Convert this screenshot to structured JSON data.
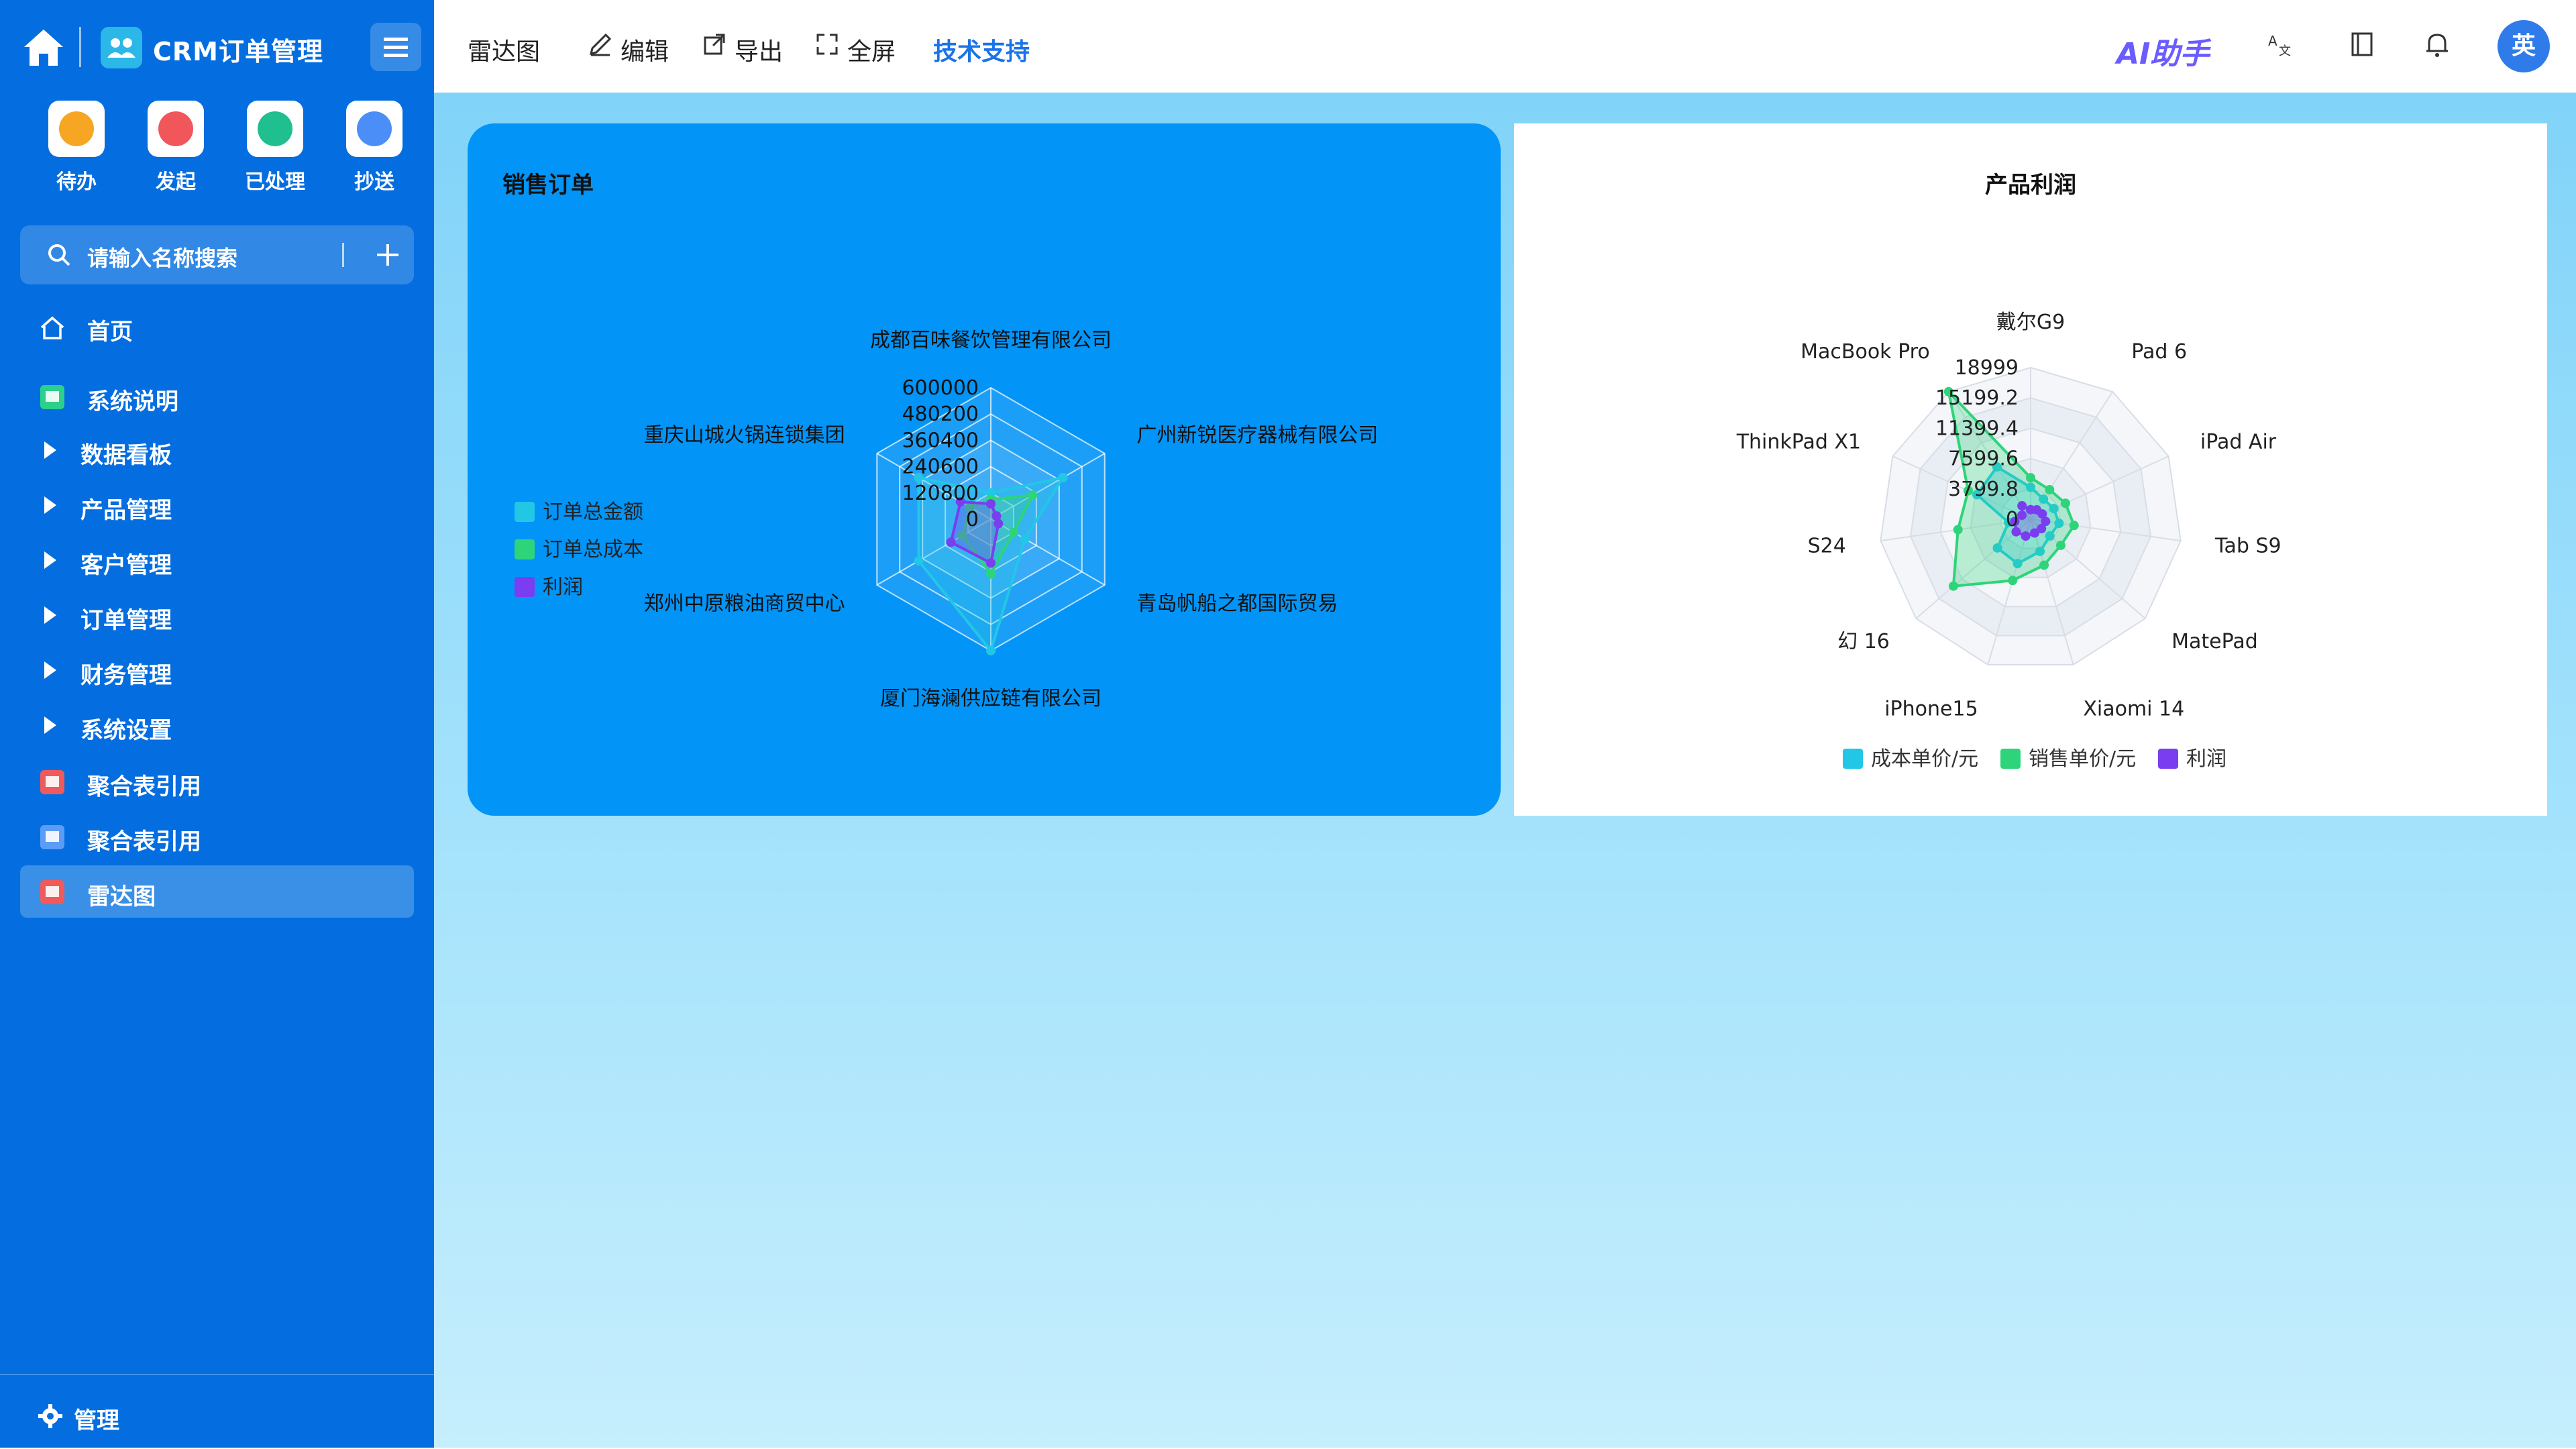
{
  "sidebar": {
    "app_title": "CRM订单管理",
    "quick_actions": [
      {
        "label": "待办",
        "icon": "bell-icon",
        "color": "#f6a623"
      },
      {
        "label": "发起",
        "icon": "play-icon",
        "color": "#f0565a"
      },
      {
        "label": "已处理",
        "icon": "check-doc-icon",
        "color": "#1fbf8f"
      },
      {
        "label": "抄送",
        "icon": "send-icon",
        "color": "#4c8ef7"
      }
    ],
    "search_placeholder": "请输入名称搜索",
    "nav": [
      {
        "label": "首页",
        "icon": "home-icon"
      },
      {
        "label": "系统说明",
        "icon": "doc-a-icon"
      },
      {
        "label": "数据看板",
        "icon": "caret-icon"
      },
      {
        "label": "产品管理",
        "icon": "caret-icon"
      },
      {
        "label": "客户管理",
        "icon": "caret-icon"
      },
      {
        "label": "订单管理",
        "icon": "caret-icon"
      },
      {
        "label": "财务管理",
        "icon": "caret-icon"
      },
      {
        "label": "系统设置",
        "icon": "caret-icon"
      },
      {
        "label": "聚合表引用",
        "icon": "chart-icon"
      },
      {
        "label": "聚合表引用",
        "icon": "file-icon"
      },
      {
        "label": "雷达图",
        "icon": "chart-icon",
        "active": true
      }
    ],
    "footer_label": "管理"
  },
  "header": {
    "page": "雷达图",
    "edit": "编辑",
    "export": "导出",
    "fullscreen": "全屏",
    "support": "技术支持",
    "ai": "AI助手",
    "avatar": "英"
  },
  "chart_data": [
    {
      "type": "radar",
      "title": "销售订单",
      "indicators": [
        "成都百味餐饮管理有限公司",
        "广州新锐医疗器械有限公司",
        "青岛帆船之都国际贸易",
        "厦门海澜供应链有限公司",
        "郑州中原粮油商贸中心",
        "重庆山城火锅连锁集团"
      ],
      "axis_ticks": [
        "0",
        "120800",
        "240600",
        "360400",
        "480200",
        "600000"
      ],
      "max": 600000,
      "legend": [
        "订单总金额",
        "订单总成本",
        "利润"
      ],
      "legend_position": "left",
      "series": [
        {
          "name": "订单总金额",
          "color": "#22c7e6",
          "values": [
            120000,
            380000,
            180000,
            600000,
            380000,
            380000
          ]
        },
        {
          "name": "订单总成本",
          "color": "#2ed47a",
          "values": [
            90000,
            220000,
            120000,
            250000,
            150000,
            110000
          ]
        },
        {
          "name": "利润",
          "color": "#7a3df0",
          "values": [
            70000,
            30000,
            40000,
            200000,
            210000,
            160000
          ]
        }
      ]
    },
    {
      "type": "radar",
      "title": "产品利润",
      "indicators": [
        "戴尔G9",
        "Pad 6",
        "iPad Air",
        "Tab S9",
        "MatePad",
        "Xiaomi 14",
        "iPhone15",
        "幻 16",
        "S24",
        "ThinkPad X1",
        "MacBook Pro"
      ],
      "axis_ticks": [
        "0",
        "3799.8",
        "7599.6",
        "11399.4",
        "15199.2",
        "18999"
      ],
      "max": 18999,
      "legend": [
        "成本单价/元",
        "销售单价/元",
        "利润"
      ],
      "legend_position": "bottom",
      "series": [
        {
          "name": "成本单价/元",
          "color": "#22c7e6",
          "values": [
            4000,
            3000,
            3200,
            3600,
            3200,
            4200,
            5800,
            5500,
            2800,
            7400,
            7800
          ]
        },
        {
          "name": "销售单价/元",
          "color": "#2ed47a",
          "values": [
            5200,
            4400,
            4800,
            5500,
            5000,
            6000,
            8000,
            12800,
            9200,
            8600,
            18999
          ]
        },
        {
          "name": "利润",
          "color": "#7a3df0",
          "values": [
            1200,
            1400,
            1600,
            1900,
            1800,
            1800,
            2200,
            2400,
            2000,
            1200,
            2000
          ]
        }
      ]
    }
  ]
}
